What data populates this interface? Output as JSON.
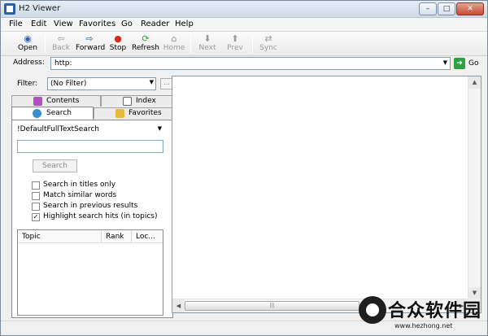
{
  "window": {
    "title": "H2 Viewer"
  },
  "menu": [
    "File",
    "Edit",
    "View",
    "Favorites",
    "Go",
    "Reader",
    "Help"
  ],
  "toolbar": {
    "open": "Open",
    "back": "Back",
    "forward": "Forward",
    "stop": "Stop",
    "refresh": "Refresh",
    "home": "Home",
    "next": "Next",
    "prev": "Prev",
    "sync": "Sync"
  },
  "address": {
    "label": "Address:",
    "value": "http:",
    "go_label": "Go"
  },
  "filter": {
    "label": "Filter:",
    "value": "(No Filter)",
    "extra_button": "..."
  },
  "tabs": {
    "contents": "Contents",
    "index": "Index",
    "search": "Search",
    "favorites": "Favorites"
  },
  "search_panel": {
    "query_type": "!DefaultFullTextSearch",
    "search_text": "",
    "search_button": "Search",
    "options": [
      {
        "label": "Search in titles only",
        "checked": false
      },
      {
        "label": "Match similar words",
        "checked": false
      },
      {
        "label": "Search in previous results",
        "checked": false
      },
      {
        "label": "Highlight search hits (in topics)",
        "checked": true
      }
    ],
    "results_columns": [
      "Topic",
      "Rank",
      "Loc..."
    ]
  },
  "watermark": {
    "text": "合众软件园",
    "url": "www.hezhong.net"
  },
  "colors": {
    "accent": "#2d5fa6",
    "go": "#2ea042",
    "stop": "#d62b1f"
  }
}
